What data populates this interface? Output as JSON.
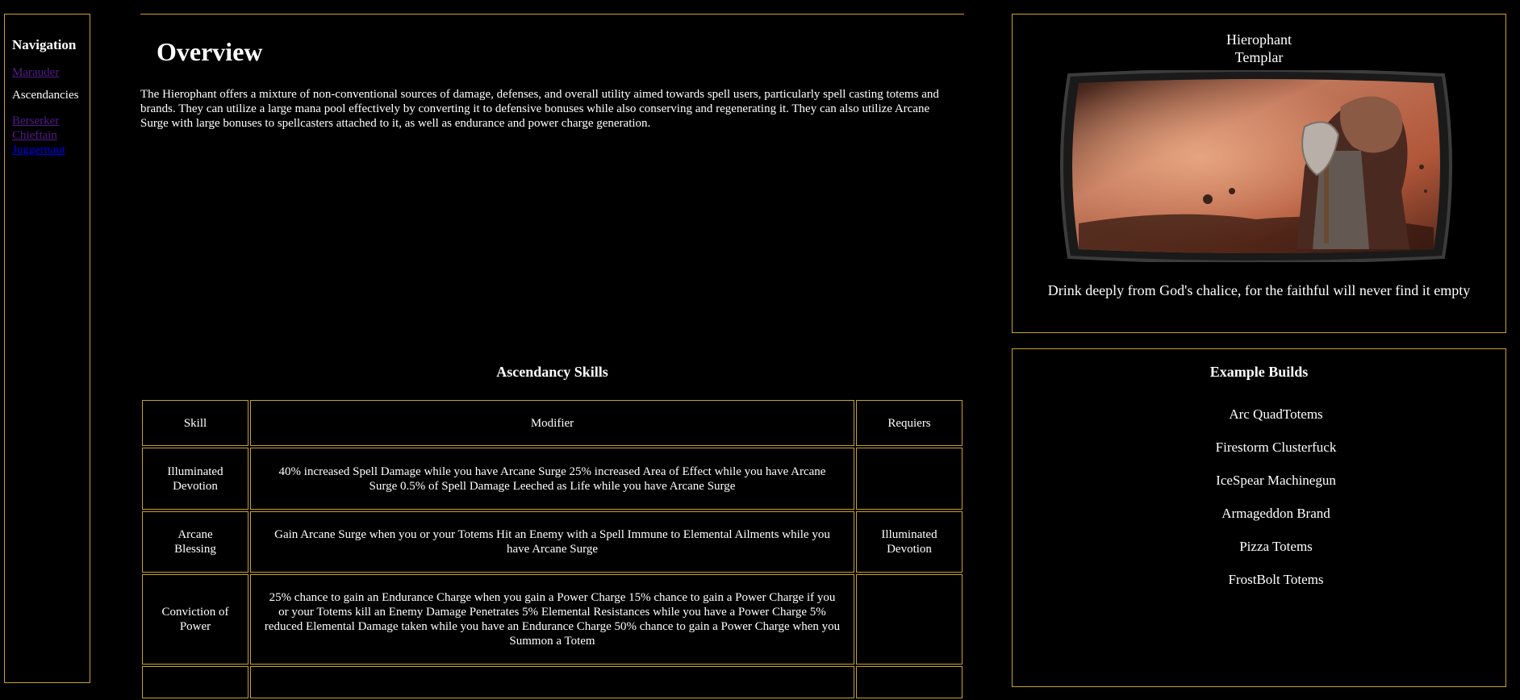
{
  "nav": {
    "heading": "Navigation",
    "marauder": "Marauder",
    "ascendancies": "Ascendancies",
    "sub": [
      "Berserker",
      "Chieftain",
      "Juggernaut"
    ]
  },
  "main": {
    "title": "Overview",
    "intro": "The Hierophant offers a mixture of non-conventional sources of damage, defenses, and overall utility aimed towards spell users, particularly spell casting totems and brands. They can utilize a large mana pool effectively by converting it to defensive bonuses while also conserving and regenerating it. They can also utilize Arcane Surge with large bonuses to spellcasters attached to it, as well as endurance and power charge generation.",
    "skills_title": "Ascendancy Skills",
    "table": {
      "headers": [
        "Skill",
        "Modifier",
        "Requiers"
      ],
      "rows": [
        {
          "skill": "Illuminated Devotion",
          "modifier": "40% increased Spell Damage while you have Arcane Surge 25% increased Area of Effect while you have Arcane Surge 0.5% of Spell Damage Leeched as Life while you have Arcane Surge",
          "req": ""
        },
        {
          "skill": "Arcane Blessing",
          "modifier": "Gain Arcane Surge when you or your Totems Hit an Enemy with a Spell Immune to Elemental Ailments while you have Arcane Surge",
          "req": "Illuminated Devotion"
        },
        {
          "skill": "Conviction of Power",
          "modifier": "25% chance to gain an Endurance Charge when you gain a Power Charge 15% chance to gain a Power Charge if you or your Totems kill an Enemy Damage Penetrates 5% Elemental Resistances while you have a Power Charge 5% reduced Elemental Damage taken while you have an Endurance Charge 50% chance to gain a Power Charge when you Summon a Totem",
          "req": ""
        }
      ]
    }
  },
  "hero": {
    "name": "Hierophant",
    "class": "Templar",
    "quote": "Drink deeply from God's chalice, for the faithful will never find it empty"
  },
  "builds": {
    "title": "Example Builds",
    "items": [
      "Arc QuadTotems",
      "Firestorm Clusterfuck",
      "IceSpear Machinegun",
      "Armageddon Brand",
      "Pizza Totems",
      "FrostBolt Totems"
    ]
  },
  "colors": {
    "border": "#c9a227",
    "visited_link": "#551a8b",
    "link": "#0000ee",
    "background": "#000000"
  }
}
